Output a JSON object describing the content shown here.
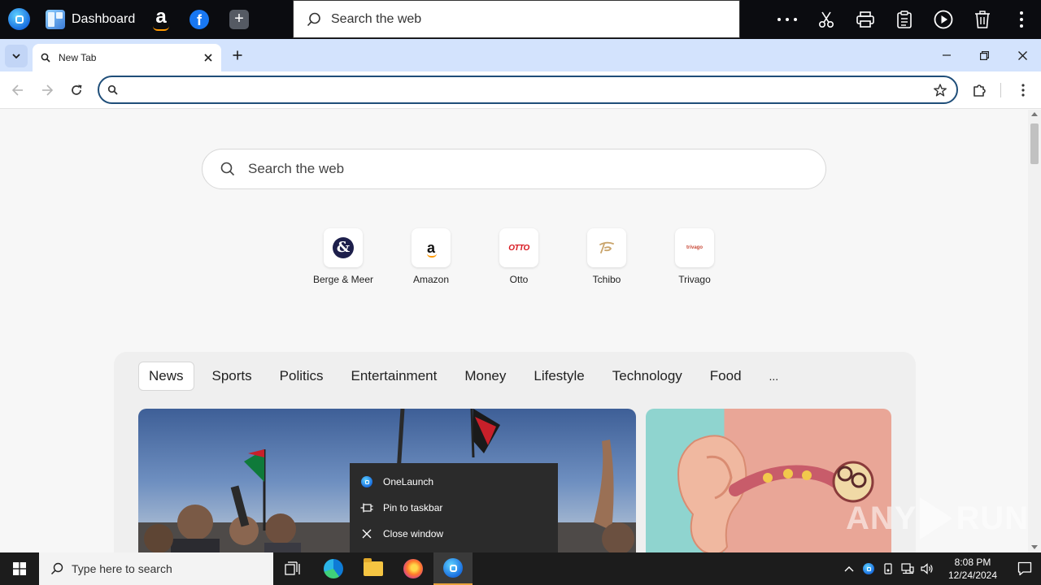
{
  "onelaunch_bar": {
    "dashboard_label": "Dashboard",
    "search_placeholder": "Search the web",
    "tools": [
      "more-icon",
      "scissors-icon",
      "printer-icon",
      "clipboard-icon",
      "play-icon",
      "trash-icon",
      "kebab-icon"
    ]
  },
  "browser": {
    "tab_title": "New Tab",
    "omnibox_value": "",
    "colors": {
      "tabstrip": "#d3e3fd",
      "omnibox_border": "#1f4e79"
    }
  },
  "page": {
    "search_placeholder": "Search the web",
    "shortcuts": [
      {
        "label": "Berge & Meer",
        "logo_text": "&"
      },
      {
        "label": "Amazon",
        "logo_text": "a"
      },
      {
        "label": "Otto",
        "logo_text": "OTTO"
      },
      {
        "label": "Tchibo",
        "logo_text": ""
      },
      {
        "label": "Trivago",
        "logo_text": "trivago"
      }
    ],
    "news_tabs": [
      "News",
      "Sports",
      "Politics",
      "Entertainment",
      "Money",
      "Lifestyle",
      "Technology",
      "Food",
      "..."
    ],
    "active_news_tab": "News"
  },
  "context_menu": {
    "items": [
      {
        "label": "OneLaunch",
        "icon": "onelaunch-icon"
      },
      {
        "label": "Pin to taskbar",
        "icon": "pin-icon"
      },
      {
        "label": "Close window",
        "icon": "close-icon"
      }
    ]
  },
  "watermark": {
    "left": "ANY",
    "right": "RUN"
  },
  "taskbar": {
    "search_placeholder": "Type here to search",
    "time": "8:08 PM",
    "date": "12/24/2024"
  }
}
